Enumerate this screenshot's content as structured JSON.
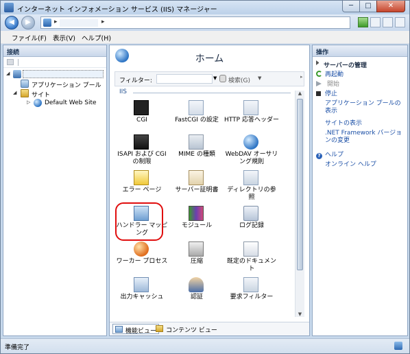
{
  "window": {
    "title": "インターネット インフォメーション サービス (IIS) マネージャー",
    "minimize_glyph": "─",
    "maximize_glyph": "□",
    "close_glyph": "✕"
  },
  "address": {
    "back_glyph": "◀",
    "forward_glyph": "▶",
    "sep1": "▸",
    "sep2": "▸"
  },
  "menu": [
    {
      "label": "ファイル(F)"
    },
    {
      "label": "表示(V)"
    },
    {
      "label": "ヘルプ(H)"
    }
  ],
  "connections": {
    "title": "接続",
    "tree": [
      {
        "label": "",
        "level": 0,
        "expander": "◢"
      },
      {
        "label": "アプリケーション プール",
        "level": 1,
        "expander": ""
      },
      {
        "label": "サイト",
        "level": 1,
        "expander": "◢"
      },
      {
        "label": "Default Web Site",
        "level": 2,
        "expander": "▷"
      }
    ]
  },
  "home": {
    "title": "ホーム",
    "filter_label": "フィルター:",
    "filter_value": "",
    "search_label": "検索(G)",
    "group_label": "IIS",
    "features": [
      {
        "label": "CGI",
        "icon": "cgi-icon"
      },
      {
        "label": "FastCGI の設定",
        "icon": "fastcgi-icon"
      },
      {
        "label": "HTTP 応答ヘッダー",
        "icon": "http-headers-icon"
      },
      {
        "label": "ISAPI および CGI の制限",
        "icon": "isapi-cgi-restrictions-icon"
      },
      {
        "label": "MIME の種類",
        "icon": "mime-types-icon"
      },
      {
        "label": "WebDAV オーサリング規則",
        "icon": "webdav-icon"
      },
      {
        "label": "エラー ページ",
        "icon": "error-pages-icon"
      },
      {
        "label": "サーバー証明書",
        "icon": "server-certificates-icon"
      },
      {
        "label": "ディレクトリの参照",
        "icon": "directory-browsing-icon"
      },
      {
        "label": "ハンドラー マッピング",
        "icon": "handler-mappings-icon"
      },
      {
        "label": "モジュール",
        "icon": "modules-icon"
      },
      {
        "label": "ログ記録",
        "icon": "logging-icon"
      },
      {
        "label": "ワーカー プロセス",
        "icon": "worker-processes-icon"
      },
      {
        "label": "圧縮",
        "icon": "compression-icon"
      },
      {
        "label": "既定のドキュメント",
        "icon": "default-document-icon"
      },
      {
        "label": "出力キャッシュ",
        "icon": "output-caching-icon"
      },
      {
        "label": "認証",
        "icon": "authentication-icon"
      },
      {
        "label": "要求フィルター",
        "icon": "request-filtering-icon"
      }
    ],
    "tabs": {
      "features_view": "機能ビュー",
      "content_view": "コンテンツ ビュー"
    }
  },
  "actions": {
    "title": "操作",
    "server_manage": "サーバーの管理",
    "restart": "再起動",
    "start": "開始",
    "stop": "停止",
    "view_app_pools": "アプリケーション プールの表示",
    "view_sites": "サイトの表示",
    "net_versions": ".NET Framework バージョンの変更",
    "help": "ヘルプ",
    "online_help": "オンライン ヘルプ"
  },
  "status": {
    "text": "準備完了"
  },
  "colors": {
    "link": "#1b4fa6",
    "highlight": "#e00d0d",
    "frame": "#c8d9ec"
  }
}
